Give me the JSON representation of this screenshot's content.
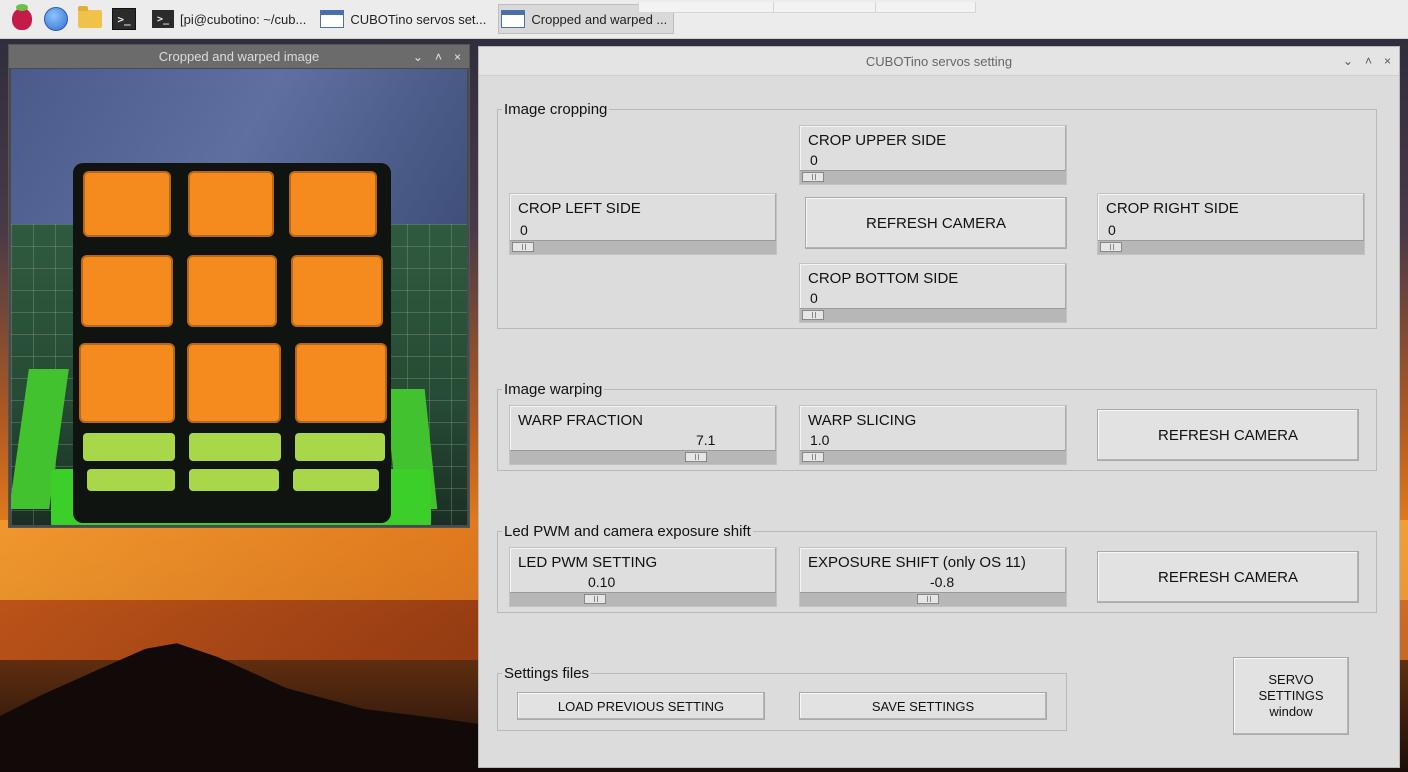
{
  "taskbar": {
    "tasks": [
      {
        "label": "[pi@cubotino: ~/cub..."
      },
      {
        "label": "CUBOTino servos set..."
      },
      {
        "label": "Cropped and warped ..."
      }
    ]
  },
  "image_window": {
    "title": "Cropped and warped image",
    "controls": [
      "⌄",
      "˄",
      "×"
    ]
  },
  "main_window": {
    "title": "CUBOTino servos setting",
    "controls": [
      "⌄",
      "˄",
      "×"
    ],
    "cropping": {
      "label": "Image cropping",
      "upper": {
        "label": "CROP UPPER SIDE",
        "value": "0",
        "level": 0
      },
      "left": {
        "label": "CROP LEFT SIDE",
        "value": "0",
        "level": 0
      },
      "right": {
        "label": "CROP RIGHT SIDE",
        "value": "0",
        "level": 0
      },
      "bottom": {
        "label": "CROP BOTTOM SIDE",
        "value": "0",
        "level": 0
      },
      "refresh": "REFRESH CAMERA"
    },
    "warping": {
      "label": "Image warping",
      "fraction": {
        "label": "WARP FRACTION",
        "value": "7.1",
        "level": 0.72
      },
      "slicing": {
        "label": "WARP SLICING",
        "value": "1.0",
        "level": 0.0
      },
      "refresh": "REFRESH CAMERA"
    },
    "led": {
      "label": "Led PWM and camera exposure shift",
      "pwm": {
        "label": "LED PWM SETTING",
        "value": "0.10",
        "level": 0.3
      },
      "exposure": {
        "label": "EXPOSURE SHIFT (only OS 11)",
        "value": "-0.8",
        "level": 0.48
      },
      "refresh": "REFRESH CAMERA"
    },
    "files": {
      "label": "Settings files",
      "load": "LOAD PREVIOUS SETTING",
      "save": "SAVE SETTINGS"
    },
    "servo_button": {
      "line1": "SERVO",
      "line2": "SETTINGS",
      "line3": "window"
    }
  }
}
